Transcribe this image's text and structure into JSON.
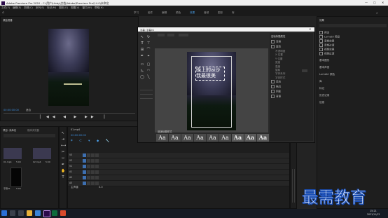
{
  "window": {
    "title": "Adobe Premiere Pro 2020 - C:\\用户\\Libby\\文档\\Adobe\\Premiere Pro\\14.0\\未命名"
  },
  "menu": [
    "文件(F)",
    "编辑(E)",
    "剪辑(C)",
    "序列(S)",
    "标记(M)",
    "图形(G)",
    "视图(V)",
    "窗口(W)",
    "帮助(H)"
  ],
  "workspaces": [
    "学习",
    "组件",
    "编辑",
    "颜色",
    "效果",
    "音频",
    "图形",
    "库"
  ],
  "active_workspace": "效果",
  "source_panel": {
    "tab": "源监视器",
    "timecode": "00:00:00:00",
    "zoom": "适合"
  },
  "project_panel": {
    "tab": "项目: 未命名",
    "bin_tab": "媒体浏览器",
    "clips": [
      {
        "label": "01.mp4",
        "duration": "5:00"
      },
      {
        "label": "02.mp4",
        "duration": "5:00"
      },
      {
        "label": "字幕01",
        "duration": "5:00"
      }
    ]
  },
  "timeline": {
    "tab": "01.mp4",
    "timecode": "00:00:00:00",
    "tracks": [
      "V3",
      "V2",
      "V1",
      "A1",
      "A2",
      "A3"
    ],
    "master": "主声道",
    "master_value": "0.0"
  },
  "title_window": {
    "title": "字幕: 字幕01",
    "subtitle_text": "晚上的ai沙\n我最很美",
    "styles_tab": "旧版标题样式",
    "properties_tab": "旧版标题属性",
    "properties": [
      "变换",
      "属性",
      "填充",
      "描边",
      "阴影",
      "背景"
    ],
    "sub_props": [
      "不透明度",
      "X 位置",
      "Y 位置",
      "宽度",
      "高度",
      "旋转",
      "字体系列",
      "字体样式",
      "字体大小",
      "宽高比",
      "行距",
      "字偶间距",
      "字符间距",
      "基线位移",
      "倾斜",
      "小型大写字母",
      "下划线",
      "扭曲"
    ],
    "style_swatch": "Aa"
  },
  "effects_panel": {
    "tab": "效果",
    "items": [
      "预设",
      "Lumetri 预设",
      "音频效果",
      "音频过渡",
      "视频效果",
      "视频过渡"
    ]
  },
  "right_panels": [
    "基本图形",
    "基本声音",
    "Lumetri 颜色",
    "库",
    "标记",
    "历史记录",
    "信息"
  ],
  "watermark": "最需教育",
  "taskbar": {
    "time": "15:21",
    "date": "2021/11/12"
  }
}
